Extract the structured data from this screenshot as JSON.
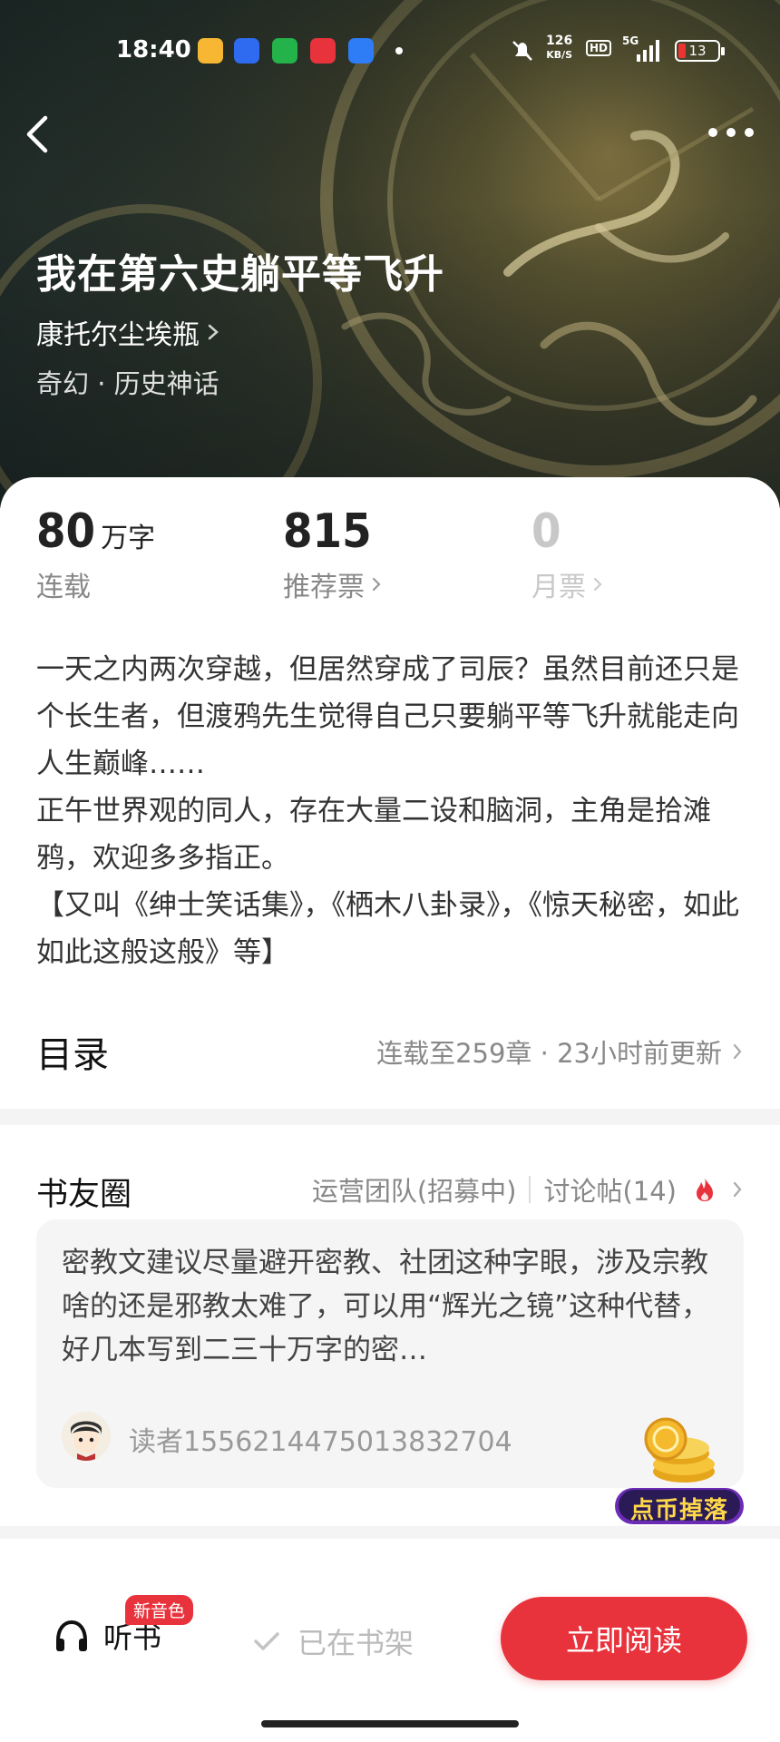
{
  "status_bar": {
    "time": "18:40",
    "net_speed_top": "126",
    "net_speed_unit": "KB/S",
    "hd": "HD",
    "signal": "5G",
    "battery": "13",
    "apps": [
      "weibo-icon",
      "baidu-icon",
      "wechat-mini-icon",
      "xiaohongshu-icon",
      "browser-icon"
    ]
  },
  "header": {
    "back_icon": "chevron-left-icon",
    "more_icon": "more-dots-icon"
  },
  "book": {
    "title": "我在第六史躺平等飞升",
    "author": "康托尔尘埃瓶",
    "genre": "奇幻 · 历史神话"
  },
  "stats": {
    "words": {
      "value": "80",
      "unit": "万字",
      "label": "连载"
    },
    "recommend": {
      "value": "815",
      "label": "推荐票"
    },
    "monthly": {
      "value": "0",
      "label": "月票"
    }
  },
  "description": [
    "一天之内两次穿越，但居然穿成了司辰？虽然目前还只是个长生者，但渡鸦先生觉得自己只要躺平等飞升就能走向人生巅峰……",
    "正午世界观的同人，存在大量二设和脑洞，主角是拾滩鸦，欢迎多多指正。",
    "【又叫《绅士笑话集》，《栖木八卦录》，《惊天秘密，如此如此这般这般》等】"
  ],
  "toc": {
    "title": "目录",
    "info": "连载至259章 · 23小时前更新"
  },
  "circle": {
    "title": "书友圈",
    "team_link": "运营团队(招募中)",
    "discuss_link": "讨论帖(14)",
    "post": {
      "text": "密教文建议尽量避开密教、社团这种字眼，涉及宗教啥的还是邪教太难了，可以用“辉光之镜”这种代替，好几本写到二三十万字的密…",
      "user": "读者1556214475013832704"
    },
    "coin_badge": "点币掉落"
  },
  "bottom_bar": {
    "listen_label": "听书",
    "new_badge": "新音色",
    "shelf_label": "已在书架",
    "read_label": "立即阅读"
  },
  "colors": {
    "accent": "#e8333c",
    "hero_bg": "#2b342c",
    "muted": "#888888"
  }
}
